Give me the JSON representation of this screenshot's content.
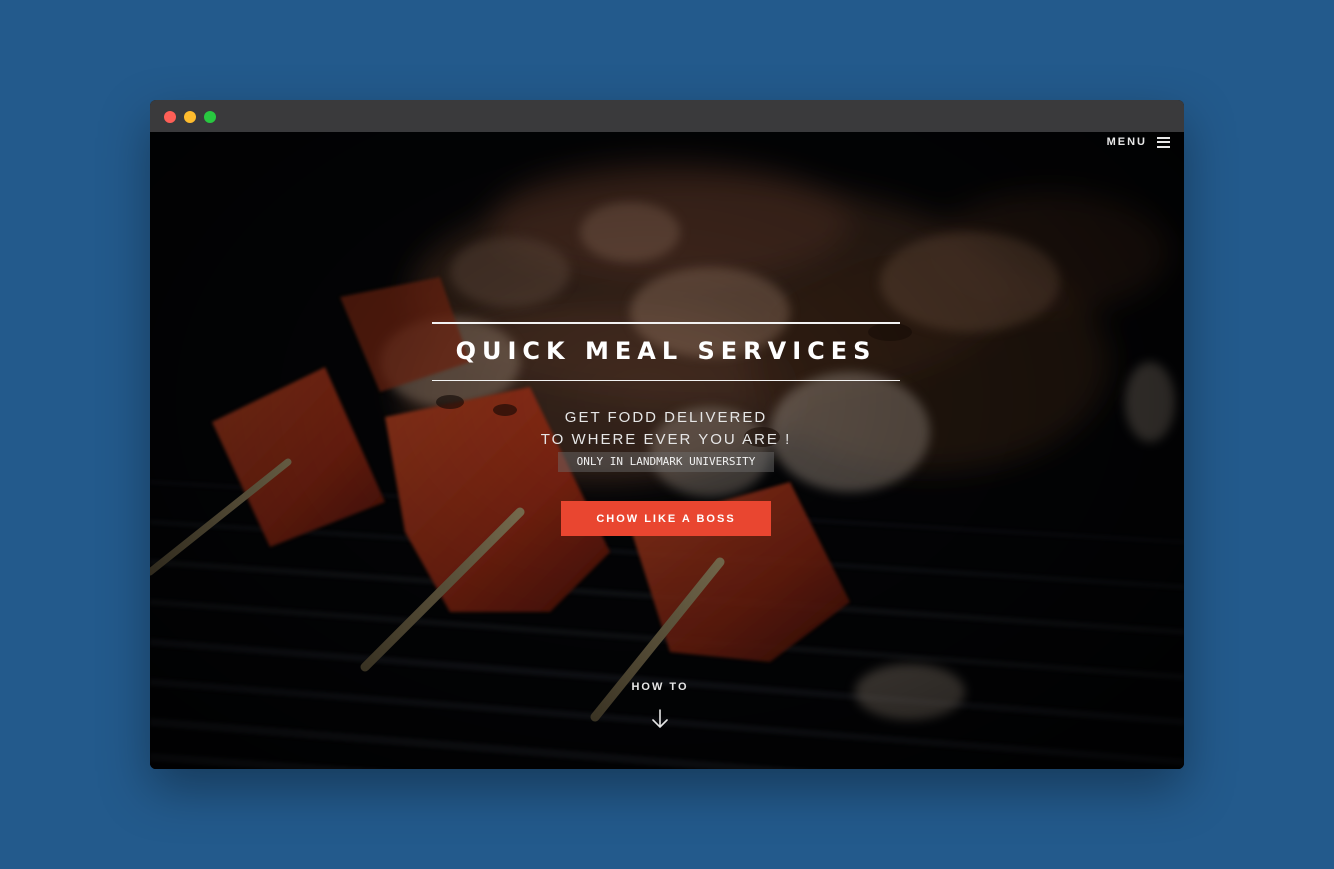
{
  "nav": {
    "menu_label": "MENU",
    "menu_icon": "hamburger-icon"
  },
  "hero": {
    "title": "QUICK MEAL SERVICES",
    "subtitle_line1": "GET FODD DELIVERED",
    "subtitle_line2": "TO WHERE EVER YOU ARE !",
    "note": "ONLY IN LANDMARK UNIVERSITY",
    "cta_label": "CHOW LIKE A BOSS",
    "scroll_label": "HOW TO",
    "scroll_icon": "arrow-down-icon"
  },
  "colors": {
    "page_background": "#235a8c",
    "accent": "#e94630",
    "titlebar": "#3a3a3c"
  }
}
